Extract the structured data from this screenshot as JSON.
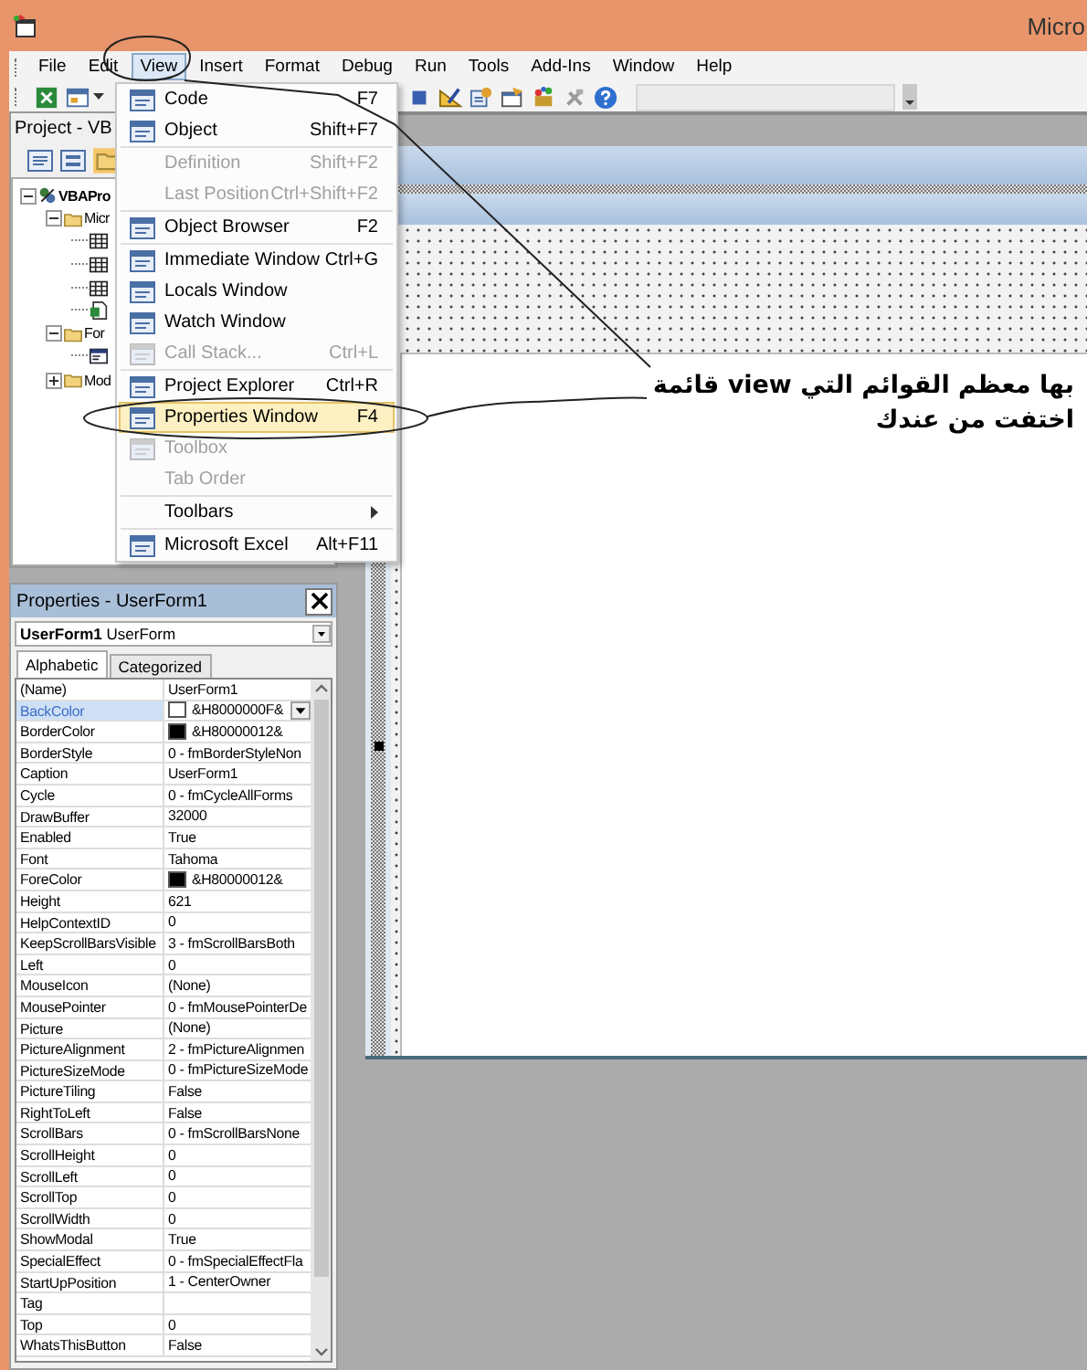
{
  "title_bar": {
    "title": "Micro"
  },
  "menu_bar": [
    {
      "label": "File",
      "selected": false
    },
    {
      "label": "Edit",
      "selected": false
    },
    {
      "label": "View",
      "selected": true
    },
    {
      "label": "Insert",
      "selected": false
    },
    {
      "label": "Format",
      "selected": false
    },
    {
      "label": "Debug",
      "selected": false
    },
    {
      "label": "Run",
      "selected": false
    },
    {
      "label": "Tools",
      "selected": false
    },
    {
      "label": "Add-Ins",
      "selected": false
    },
    {
      "label": "Window",
      "selected": false
    },
    {
      "label": "Help",
      "selected": false
    }
  ],
  "project_pane": {
    "title": "Project - VB",
    "tree": [
      {
        "kind": "project",
        "label": "VBAPro",
        "expanded": true,
        "children": [
          {
            "kind": "folder",
            "label": "Micr",
            "expanded": true,
            "children": [
              {
                "kind": "sheet"
              },
              {
                "kind": "sheet"
              },
              {
                "kind": "sheet"
              },
              {
                "kind": "workbook"
              }
            ]
          },
          {
            "kind": "folder",
            "label": "For",
            "expanded": true,
            "children": [
              {
                "kind": "form"
              }
            ]
          },
          {
            "kind": "folder",
            "label": "Mod",
            "expanded": false
          }
        ]
      }
    ]
  },
  "properties_pane": {
    "title": "Properties - UserForm1",
    "object_selector": "**UserForm1** UserForm",
    "tabs": [
      {
        "label": "Alphabetic",
        "selected": true
      },
      {
        "label": "Categorized",
        "selected": false
      }
    ],
    "rows": [
      {
        "name": "(Name)",
        "value": "UserForm1",
        "selected": false
      },
      {
        "name": "BackColor",
        "value": "&H8000000F&",
        "color": "#ffffff",
        "selected": true
      },
      {
        "name": "BorderColor",
        "value": "&H80000012&",
        "color": "#000000",
        "selected": false
      },
      {
        "name": "BorderStyle",
        "value": "0 - fmBorderStyleNon",
        "selected": false
      },
      {
        "name": "Caption",
        "value": "UserForm1",
        "selected": false
      },
      {
        "name": "Cycle",
        "value": "0 - fmCycleAllForms",
        "selected": false
      },
      {
        "name": "DrawBuffer",
        "value": "32000",
        "selected": false
      },
      {
        "name": "Enabled",
        "value": "True",
        "selected": false
      },
      {
        "name": "Font",
        "value": "Tahoma",
        "selected": false
      },
      {
        "name": "ForeColor",
        "value": "&H80000012&",
        "color": "#000000",
        "selected": false
      },
      {
        "name": "Height",
        "value": "621",
        "selected": false
      },
      {
        "name": "HelpContextID",
        "value": "0",
        "selected": false
      },
      {
        "name": "KeepScrollBarsVisible",
        "value": "3 - fmScrollBarsBoth",
        "selected": false
      },
      {
        "name": "Left",
        "value": "0",
        "selected": false
      },
      {
        "name": "MouseIcon",
        "value": "(None)",
        "selected": false
      },
      {
        "name": "MousePointer",
        "value": "0 - fmMousePointerDe",
        "selected": false
      },
      {
        "name": "Picture",
        "value": "(None)",
        "selected": false
      },
      {
        "name": "PictureAlignment",
        "value": "2 - fmPictureAlignmen",
        "selected": false
      },
      {
        "name": "PictureSizeMode",
        "value": "0 - fmPictureSizeMode",
        "selected": false
      },
      {
        "name": "PictureTiling",
        "value": "False",
        "selected": false
      },
      {
        "name": "RightToLeft",
        "value": "False",
        "selected": false
      },
      {
        "name": "ScrollBars",
        "value": "0 - fmScrollBarsNone",
        "selected": false
      },
      {
        "name": "ScrollHeight",
        "value": "0",
        "selected": false
      },
      {
        "name": "ScrollLeft",
        "value": "0",
        "selected": false
      },
      {
        "name": "ScrollTop",
        "value": "0",
        "selected": false
      },
      {
        "name": "ScrollWidth",
        "value": "0",
        "selected": false
      },
      {
        "name": "ShowModal",
        "value": "True",
        "selected": false
      },
      {
        "name": "SpecialEffect",
        "value": "0 - fmSpecialEffectFla",
        "selected": false
      },
      {
        "name": "StartUpPosition",
        "value": "1 - CenterOwner",
        "selected": false
      },
      {
        "name": "Tag",
        "selected": false
      },
      {
        "name": "Top",
        "value": "0",
        "selected": false
      },
      {
        "name": "WhatsThisButton",
        "value": "False",
        "selected": false
      }
    ]
  },
  "view_menu": {
    "items": [
      {
        "kind": "item",
        "label": "Code",
        "shortcut": "F7",
        "icon": true,
        "disabled": false,
        "selected": false
      },
      {
        "kind": "item",
        "label": "Object",
        "shortcut": "Shift+F7",
        "icon": true,
        "disabled": false,
        "selected": false
      },
      {
        "kind": "separator"
      },
      {
        "kind": "item",
        "label": "Definition",
        "shortcut": "Shift+F2",
        "icon": false,
        "disabled": true,
        "selected": false
      },
      {
        "kind": "item",
        "label": "Last Position",
        "shortcut": "Ctrl+Shift+F2",
        "icon": false,
        "disabled": true,
        "selected": false
      },
      {
        "kind": "separator"
      },
      {
        "kind": "item",
        "label": "Object Browser",
        "shortcut": "F2",
        "icon": true,
        "disabled": false,
        "selected": false
      },
      {
        "kind": "separator"
      },
      {
        "kind": "item",
        "label": "Immediate Window",
        "shortcut": "Ctrl+G",
        "icon": true,
        "disabled": false,
        "selected": false
      },
      {
        "kind": "item",
        "label": "Locals Window",
        "icon": true,
        "disabled": false,
        "selected": false
      },
      {
        "kind": "item",
        "label": "Watch Window",
        "icon": true,
        "disabled": false,
        "selected": false
      },
      {
        "kind": "item",
        "label": "Call Stack...",
        "shortcut": "Ctrl+L",
        "icon": true,
        "disabled": true,
        "selected": false
      },
      {
        "kind": "separator"
      },
      {
        "kind": "item",
        "label": "Project Explorer",
        "shortcut": "Ctrl+R",
        "icon": true,
        "disabled": false,
        "selected": false
      },
      {
        "kind": "item",
        "label": "Properties Window",
        "shortcut": "F4",
        "icon": true,
        "disabled": false,
        "selected": true
      },
      {
        "kind": "item",
        "label": "Toolbox",
        "icon": true,
        "disabled": true,
        "selected": false
      },
      {
        "kind": "item",
        "label": "Tab Order",
        "icon": false,
        "disabled": true,
        "selected": false
      },
      {
        "kind": "separator"
      },
      {
        "kind": "item",
        "label": "Toolbars",
        "icon": false,
        "disabled": false,
        "selected": false,
        "submenu": true
      },
      {
        "kind": "separator"
      },
      {
        "kind": "item",
        "label": "Microsoft Excel",
        "shortcut": "Alt+F11",
        "icon": true,
        "disabled": false,
        "selected": false
      }
    ]
  },
  "annotation": {
    "lines": [
      "بها معظم القوائم التي view قائمة",
      "اختفت من عندك"
    ]
  }
}
